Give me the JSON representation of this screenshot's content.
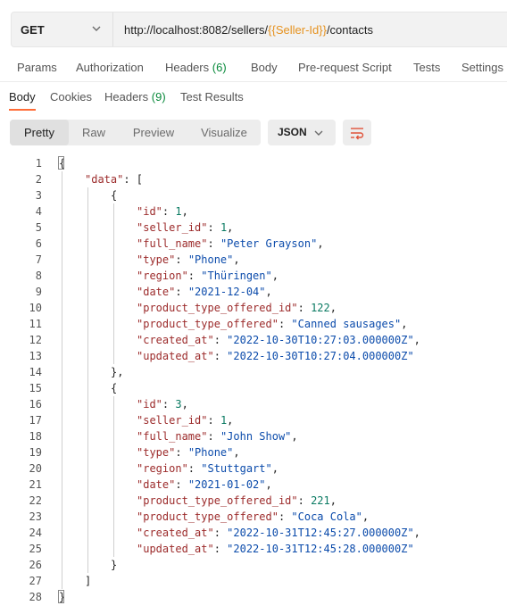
{
  "request": {
    "method": "GET",
    "url_prefix": "http://localhost:8082/sellers/",
    "url_variable": "{{Seller-Id}}",
    "url_suffix": "/contacts"
  },
  "request_tabs": [
    {
      "label": "Params",
      "count": ""
    },
    {
      "label": "Authorization",
      "count": ""
    },
    {
      "label": "Headers",
      "count": "(6)"
    },
    {
      "label": "Body",
      "count": ""
    },
    {
      "label": "Pre-request Script",
      "count": ""
    },
    {
      "label": "Tests",
      "count": ""
    },
    {
      "label": "Settings",
      "count": ""
    }
  ],
  "response_tabs": [
    {
      "label": "Body",
      "count": "",
      "active": true
    },
    {
      "label": "Cookies",
      "count": "",
      "active": false
    },
    {
      "label": "Headers",
      "count": "(9)",
      "active": false
    },
    {
      "label": "Test Results",
      "count": "",
      "active": false
    }
  ],
  "view_modes": [
    {
      "label": "Pretty",
      "active": true
    },
    {
      "label": "Raw",
      "active": false
    },
    {
      "label": "Preview",
      "active": false
    },
    {
      "label": "Visualize",
      "active": false
    }
  ],
  "format": "JSON",
  "icons": {
    "method_dropdown": "chevron-down-icon",
    "format_dropdown": "chevron-down-icon",
    "wrap": "wrap-lines-icon"
  },
  "colors": {
    "accent": "#ff6c37",
    "variable": "#e6921f",
    "count": "#0a8a3c",
    "json_key": "#9c2b2b",
    "json_string": "#0b4bab",
    "json_number": "#0a7a62"
  },
  "code_lines": [
    {
      "n": "1",
      "indent": 0,
      "tokens": [
        {
          "t": "p",
          "v": "{"
        }
      ]
    },
    {
      "n": "2",
      "indent": 1,
      "tokens": [
        {
          "t": "k",
          "v": "\"data\""
        },
        {
          "t": "p",
          "v": ": ["
        }
      ]
    },
    {
      "n": "3",
      "indent": 2,
      "tokens": [
        {
          "t": "p",
          "v": "{"
        }
      ]
    },
    {
      "n": "4",
      "indent": 3,
      "tokens": [
        {
          "t": "k",
          "v": "\"id\""
        },
        {
          "t": "p",
          "v": ": "
        },
        {
          "t": "n",
          "v": "1"
        },
        {
          "t": "p",
          "v": ","
        }
      ]
    },
    {
      "n": "5",
      "indent": 3,
      "tokens": [
        {
          "t": "k",
          "v": "\"seller_id\""
        },
        {
          "t": "p",
          "v": ": "
        },
        {
          "t": "n",
          "v": "1"
        },
        {
          "t": "p",
          "v": ","
        }
      ]
    },
    {
      "n": "6",
      "indent": 3,
      "tokens": [
        {
          "t": "k",
          "v": "\"full_name\""
        },
        {
          "t": "p",
          "v": ": "
        },
        {
          "t": "s",
          "v": "\"Peter Grayson\""
        },
        {
          "t": "p",
          "v": ","
        }
      ]
    },
    {
      "n": "7",
      "indent": 3,
      "tokens": [
        {
          "t": "k",
          "v": "\"type\""
        },
        {
          "t": "p",
          "v": ": "
        },
        {
          "t": "s",
          "v": "\"Phone\""
        },
        {
          "t": "p",
          "v": ","
        }
      ]
    },
    {
      "n": "8",
      "indent": 3,
      "tokens": [
        {
          "t": "k",
          "v": "\"region\""
        },
        {
          "t": "p",
          "v": ": "
        },
        {
          "t": "s",
          "v": "\"Thüringen\""
        },
        {
          "t": "p",
          "v": ","
        }
      ]
    },
    {
      "n": "9",
      "indent": 3,
      "tokens": [
        {
          "t": "k",
          "v": "\"date\""
        },
        {
          "t": "p",
          "v": ": "
        },
        {
          "t": "s",
          "v": "\"2021-12-04\""
        },
        {
          "t": "p",
          "v": ","
        }
      ]
    },
    {
      "n": "10",
      "indent": 3,
      "tokens": [
        {
          "t": "k",
          "v": "\"product_type_offered_id\""
        },
        {
          "t": "p",
          "v": ": "
        },
        {
          "t": "n",
          "v": "122"
        },
        {
          "t": "p",
          "v": ","
        }
      ]
    },
    {
      "n": "11",
      "indent": 3,
      "tokens": [
        {
          "t": "k",
          "v": "\"product_type_offered\""
        },
        {
          "t": "p",
          "v": ": "
        },
        {
          "t": "s",
          "v": "\"Canned sausages\""
        },
        {
          "t": "p",
          "v": ","
        }
      ]
    },
    {
      "n": "12",
      "indent": 3,
      "tokens": [
        {
          "t": "k",
          "v": "\"created_at\""
        },
        {
          "t": "p",
          "v": ": "
        },
        {
          "t": "s",
          "v": "\"2022-10-30T10:27:03.000000Z\""
        },
        {
          "t": "p",
          "v": ","
        }
      ]
    },
    {
      "n": "13",
      "indent": 3,
      "tokens": [
        {
          "t": "k",
          "v": "\"updated_at\""
        },
        {
          "t": "p",
          "v": ": "
        },
        {
          "t": "s",
          "v": "\"2022-10-30T10:27:04.000000Z\""
        }
      ]
    },
    {
      "n": "14",
      "indent": 2,
      "tokens": [
        {
          "t": "p",
          "v": "},"
        }
      ]
    },
    {
      "n": "15",
      "indent": 2,
      "tokens": [
        {
          "t": "p",
          "v": "{"
        }
      ]
    },
    {
      "n": "16",
      "indent": 3,
      "tokens": [
        {
          "t": "k",
          "v": "\"id\""
        },
        {
          "t": "p",
          "v": ": "
        },
        {
          "t": "n",
          "v": "3"
        },
        {
          "t": "p",
          "v": ","
        }
      ]
    },
    {
      "n": "17",
      "indent": 3,
      "tokens": [
        {
          "t": "k",
          "v": "\"seller_id\""
        },
        {
          "t": "p",
          "v": ": "
        },
        {
          "t": "n",
          "v": "1"
        },
        {
          "t": "p",
          "v": ","
        }
      ]
    },
    {
      "n": "18",
      "indent": 3,
      "tokens": [
        {
          "t": "k",
          "v": "\"full_name\""
        },
        {
          "t": "p",
          "v": ": "
        },
        {
          "t": "s",
          "v": "\"John Show\""
        },
        {
          "t": "p",
          "v": ","
        }
      ]
    },
    {
      "n": "19",
      "indent": 3,
      "tokens": [
        {
          "t": "k",
          "v": "\"type\""
        },
        {
          "t": "p",
          "v": ": "
        },
        {
          "t": "s",
          "v": "\"Phone\""
        },
        {
          "t": "p",
          "v": ","
        }
      ]
    },
    {
      "n": "20",
      "indent": 3,
      "tokens": [
        {
          "t": "k",
          "v": "\"region\""
        },
        {
          "t": "p",
          "v": ": "
        },
        {
          "t": "s",
          "v": "\"Stuttgart\""
        },
        {
          "t": "p",
          "v": ","
        }
      ]
    },
    {
      "n": "21",
      "indent": 3,
      "tokens": [
        {
          "t": "k",
          "v": "\"date\""
        },
        {
          "t": "p",
          "v": ": "
        },
        {
          "t": "s",
          "v": "\"2021-01-02\""
        },
        {
          "t": "p",
          "v": ","
        }
      ]
    },
    {
      "n": "22",
      "indent": 3,
      "tokens": [
        {
          "t": "k",
          "v": "\"product_type_offered_id\""
        },
        {
          "t": "p",
          "v": ": "
        },
        {
          "t": "n",
          "v": "221"
        },
        {
          "t": "p",
          "v": ","
        }
      ]
    },
    {
      "n": "23",
      "indent": 3,
      "tokens": [
        {
          "t": "k",
          "v": "\"product_type_offered\""
        },
        {
          "t": "p",
          "v": ": "
        },
        {
          "t": "s",
          "v": "\"Coca Cola\""
        },
        {
          "t": "p",
          "v": ","
        }
      ]
    },
    {
      "n": "24",
      "indent": 3,
      "tokens": [
        {
          "t": "k",
          "v": "\"created_at\""
        },
        {
          "t": "p",
          "v": ": "
        },
        {
          "t": "s",
          "v": "\"2022-10-31T12:45:27.000000Z\""
        },
        {
          "t": "p",
          "v": ","
        }
      ]
    },
    {
      "n": "25",
      "indent": 3,
      "tokens": [
        {
          "t": "k",
          "v": "\"updated_at\""
        },
        {
          "t": "p",
          "v": ": "
        },
        {
          "t": "s",
          "v": "\"2022-10-31T12:45:28.000000Z\""
        }
      ]
    },
    {
      "n": "26",
      "indent": 2,
      "tokens": [
        {
          "t": "p",
          "v": "}"
        }
      ]
    },
    {
      "n": "27",
      "indent": 1,
      "tokens": [
        {
          "t": "p",
          "v": "]"
        }
      ]
    },
    {
      "n": "28",
      "indent": 0,
      "tokens": [
        {
          "t": "p",
          "v": "}"
        }
      ]
    }
  ]
}
